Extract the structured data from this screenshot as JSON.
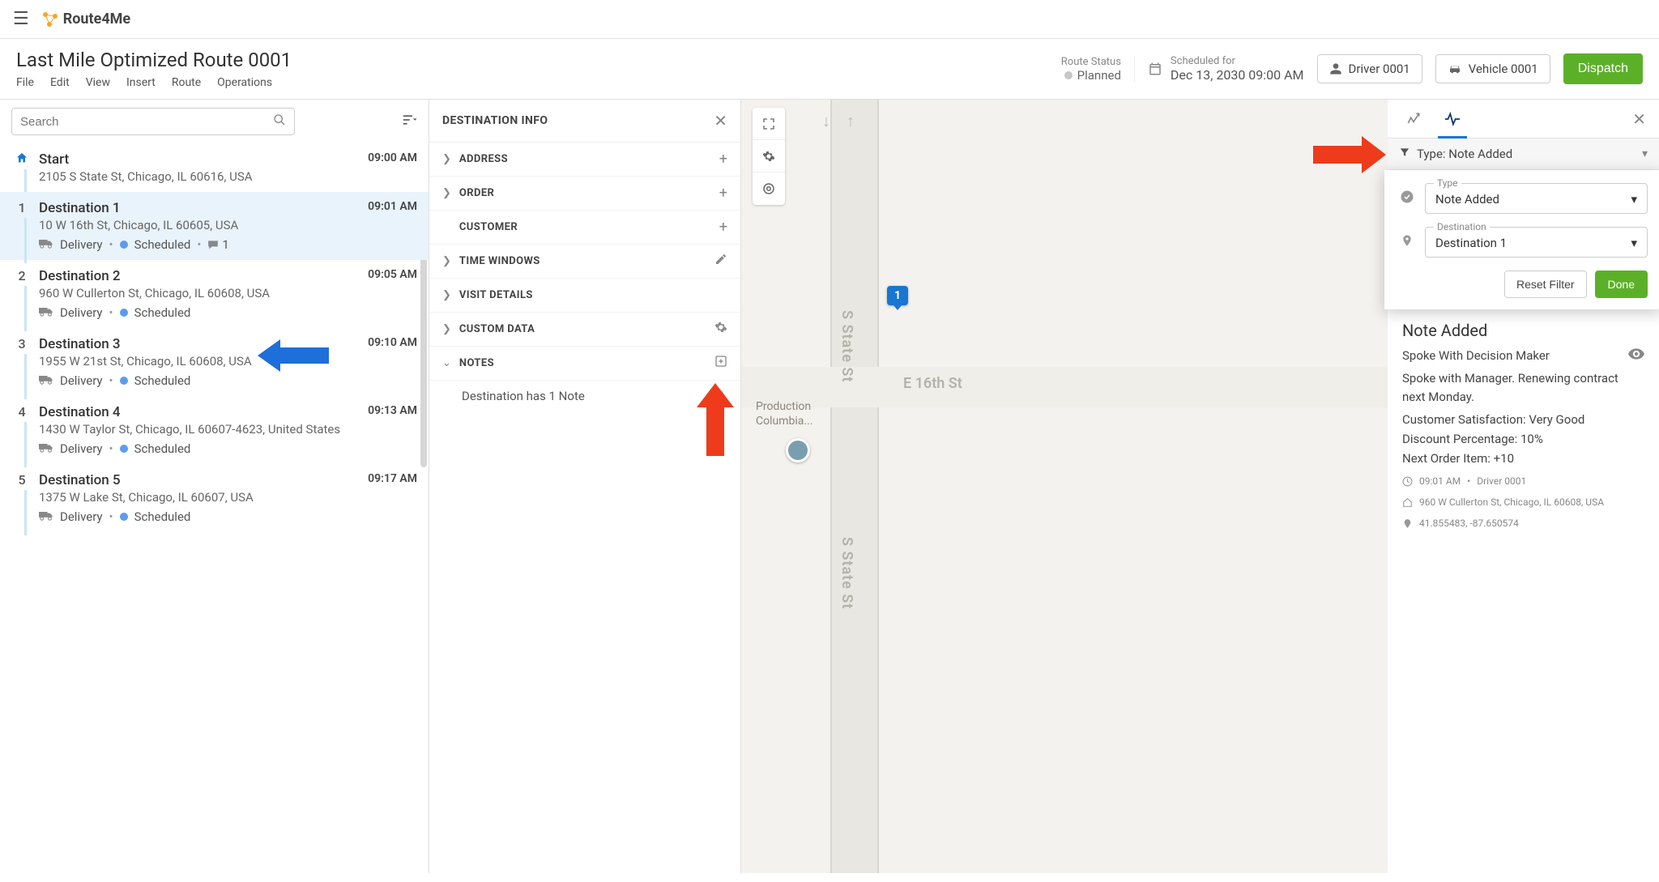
{
  "app": {
    "brand": "Route4Me"
  },
  "route": {
    "title": "Last Mile Optimized Route 0001",
    "status_label": "Route Status",
    "status_value": "Planned",
    "scheduled_label": "Scheduled for",
    "scheduled_value": "Dec 13, 2030 09:00 AM",
    "driver": "Driver 0001",
    "vehicle": "Vehicle 0001",
    "dispatch": "Dispatch"
  },
  "menu": {
    "file": "File",
    "edit": "Edit",
    "view": "View",
    "insert": "Insert",
    "route": "Route",
    "operations": "Operations"
  },
  "search": {
    "placeholder": "Search"
  },
  "stops": [
    {
      "num": "",
      "name": "Start",
      "addr": "2105 S State St, Chicago, IL 60616, USA",
      "time": "09:00 AM",
      "is_start": true
    },
    {
      "num": "1",
      "name": "Destination 1",
      "addr": "10 W 16th St, Chicago, IL 60605, USA",
      "time": "09:01 AM",
      "type": "Delivery",
      "status": "Scheduled",
      "notes": "1",
      "selected": true
    },
    {
      "num": "2",
      "name": "Destination 2",
      "addr": "960 W Cullerton St, Chicago, IL 60608, USA",
      "time": "09:05 AM",
      "type": "Delivery",
      "status": "Scheduled"
    },
    {
      "num": "3",
      "name": "Destination 3",
      "addr": "1955 W 21st St, Chicago, IL 60608, USA",
      "time": "09:10 AM",
      "type": "Delivery",
      "status": "Scheduled"
    },
    {
      "num": "4",
      "name": "Destination 4",
      "addr": "1430 W Taylor St, Chicago, IL 60607-4623, United States",
      "time": "09:13 AM",
      "type": "Delivery",
      "status": "Scheduled"
    },
    {
      "num": "5",
      "name": "Destination 5",
      "addr": "1375 W Lake St, Chicago, IL 60607, USA",
      "time": "09:17 AM",
      "type": "Delivery",
      "status": "Scheduled"
    }
  ],
  "detail": {
    "title": "DESTINATION INFO",
    "sections": {
      "address": "ADDRESS",
      "order": "ORDER",
      "customer": "CUSTOMER",
      "time_windows": "TIME WINDOWS",
      "visit_details": "VISIT DETAILS",
      "custom_data": "CUSTOM DATA",
      "notes": "NOTES"
    },
    "notes_line": "Destination has 1 Note"
  },
  "map": {
    "road_v": "S State St",
    "road_h": "E 16th St",
    "poi1": "Production",
    "poi2": "Columbia...",
    "pin": "1"
  },
  "rpanel": {
    "filter_label": "Type: Note Added",
    "type_label": "Type",
    "type_value": "Note Added",
    "dest_label": "Destination",
    "dest_value": "Destination 1",
    "reset": "Reset Filter",
    "done": "Done",
    "note_title": "Note Added",
    "note_sub": "Spoke With Decision Maker",
    "note_body": "Spoke with Manager. Renewing contract next Monday.",
    "kv1": "Customer Satisfaction: Very Good",
    "kv2": "Discount Percentage: 10%",
    "kv3": "Next Order Item: +10",
    "time": "09:01 AM",
    "driver": "Driver 0001",
    "addr": "960 W Cullerton St, Chicago, IL 60608, USA",
    "coords": "41.855483, -87.650574"
  }
}
